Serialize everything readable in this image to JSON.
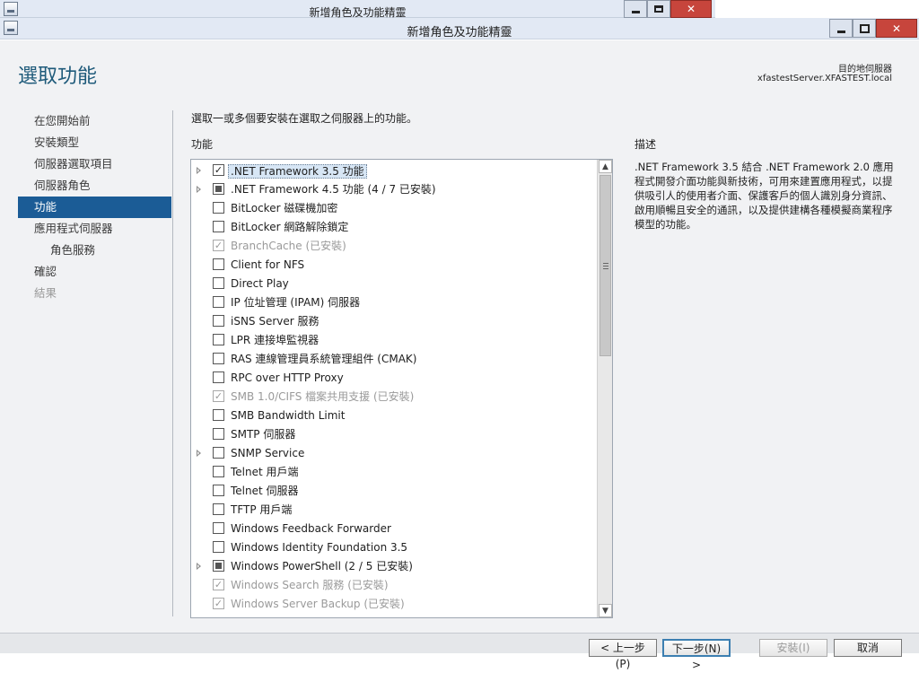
{
  "back_window": {
    "title": "新增角色及功能精靈"
  },
  "window": {
    "title": "新增角色及功能精靈"
  },
  "page": {
    "title": "選取功能",
    "destination_label": "目的地伺服器",
    "destination_server": "xfastestServer.XFASTEST.local",
    "intro": "選取一或多個要安裝在選取之伺服器上的功能。",
    "features_header": "功能",
    "description_header": "描述",
    "description_text": ".NET Framework 3.5 結合 .NET Framework 2.0 應用程式開發介面功能與新技術，可用來建置應用程式，以提供吸引人的使用者介面、保護客戶的個人識別身分資訊、啟用順暢且安全的通訊，以及提供建構各種模擬商業程序模型的功能。"
  },
  "nav": {
    "items": [
      {
        "label": "在您開始前",
        "state": "normal",
        "level": 0
      },
      {
        "label": "安裝類型",
        "state": "normal",
        "level": 0
      },
      {
        "label": "伺服器選取項目",
        "state": "normal",
        "level": 0
      },
      {
        "label": "伺服器角色",
        "state": "normal",
        "level": 0
      },
      {
        "label": "功能",
        "state": "active",
        "level": 0
      },
      {
        "label": "應用程式伺服器",
        "state": "normal",
        "level": 0
      },
      {
        "label": "角色服務",
        "state": "normal",
        "level": 1
      },
      {
        "label": "確認",
        "state": "normal",
        "level": 0
      },
      {
        "label": "結果",
        "state": "disabled",
        "level": 0
      }
    ]
  },
  "features": [
    {
      "label": ".NET Framework 3.5 功能",
      "check": "checked",
      "expandable": true,
      "disabled": false,
      "selected": true
    },
    {
      "label": ".NET Framework 4.5 功能 (4 / 7 已安裝)",
      "check": "partial",
      "expandable": true,
      "disabled": false,
      "selected": false
    },
    {
      "label": "BitLocker 磁碟機加密",
      "check": "none",
      "expandable": false,
      "disabled": false,
      "selected": false
    },
    {
      "label": "BitLocker 網路解除鎖定",
      "check": "none",
      "expandable": false,
      "disabled": false,
      "selected": false
    },
    {
      "label": "BranchCache (已安裝)",
      "check": "checked",
      "expandable": false,
      "disabled": true,
      "selected": false
    },
    {
      "label": "Client for NFS",
      "check": "none",
      "expandable": false,
      "disabled": false,
      "selected": false
    },
    {
      "label": "Direct Play",
      "check": "none",
      "expandable": false,
      "disabled": false,
      "selected": false
    },
    {
      "label": "IP 位址管理 (IPAM) 伺服器",
      "check": "none",
      "expandable": false,
      "disabled": false,
      "selected": false
    },
    {
      "label": "iSNS Server 服務",
      "check": "none",
      "expandable": false,
      "disabled": false,
      "selected": false
    },
    {
      "label": "LPR 連接埠監視器",
      "check": "none",
      "expandable": false,
      "disabled": false,
      "selected": false
    },
    {
      "label": "RAS 連線管理員系統管理組件 (CMAK)",
      "check": "none",
      "expandable": false,
      "disabled": false,
      "selected": false
    },
    {
      "label": "RPC over HTTP Proxy",
      "check": "none",
      "expandable": false,
      "disabled": false,
      "selected": false
    },
    {
      "label": "SMB 1.0/CIFS 檔案共用支援 (已安裝)",
      "check": "checked",
      "expandable": false,
      "disabled": true,
      "selected": false
    },
    {
      "label": "SMB Bandwidth Limit",
      "check": "none",
      "expandable": false,
      "disabled": false,
      "selected": false
    },
    {
      "label": "SMTP 伺服器",
      "check": "none",
      "expandable": false,
      "disabled": false,
      "selected": false
    },
    {
      "label": "SNMP Service",
      "check": "none",
      "expandable": true,
      "disabled": false,
      "selected": false
    },
    {
      "label": "Telnet 用戶端",
      "check": "none",
      "expandable": false,
      "disabled": false,
      "selected": false
    },
    {
      "label": "Telnet 伺服器",
      "check": "none",
      "expandable": false,
      "disabled": false,
      "selected": false
    },
    {
      "label": "TFTP 用戶端",
      "check": "none",
      "expandable": false,
      "disabled": false,
      "selected": false
    },
    {
      "label": "Windows Feedback Forwarder",
      "check": "none",
      "expandable": false,
      "disabled": false,
      "selected": false
    },
    {
      "label": "Windows Identity Foundation 3.5",
      "check": "none",
      "expandable": false,
      "disabled": false,
      "selected": false
    },
    {
      "label": "Windows PowerShell (2 / 5 已安裝)",
      "check": "partial",
      "expandable": true,
      "disabled": false,
      "selected": false
    },
    {
      "label": "Windows Search 服務 (已安裝)",
      "check": "checked",
      "expandable": false,
      "disabled": true,
      "selected": false
    },
    {
      "label": "Windows Server Backup (已安裝)",
      "check": "checked",
      "expandable": false,
      "disabled": true,
      "selected": false
    }
  ],
  "buttons": {
    "previous": "< 上一步(P)",
    "next": "下一步(N) >",
    "install": "安裝(I)",
    "cancel": "取消"
  },
  "icons": {
    "app": "server-manager-icon",
    "minimize": "minimize-icon",
    "maximize": "maximize-icon",
    "restore": "restore-icon",
    "close": "close-icon",
    "expander": "triangle-right-icon",
    "scroll_up": "chevron-up-icon",
    "scroll_down": "chevron-down-icon"
  },
  "colors": {
    "title_accent": "#1e5a7a",
    "nav_active": "#1b5c96",
    "close_button": "#c7453c",
    "titlebar": "#e2e9f4"
  }
}
